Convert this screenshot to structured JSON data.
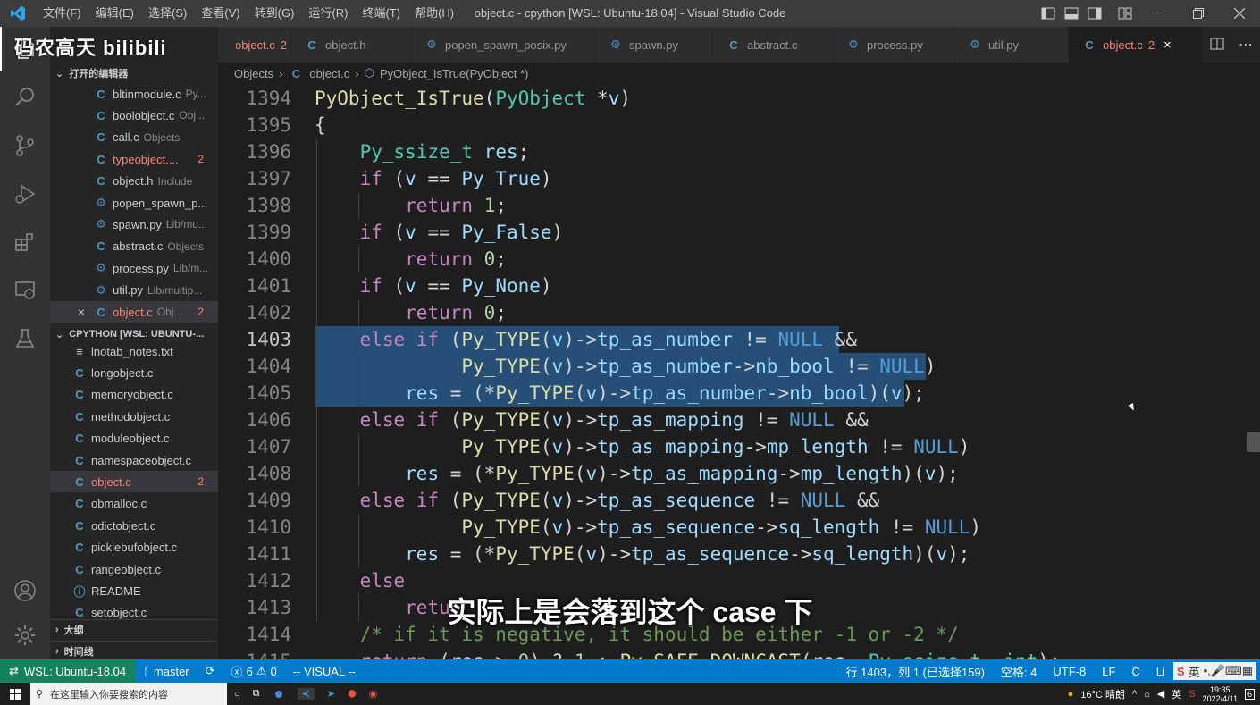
{
  "titlebar": {
    "menu": [
      "文件(F)",
      "编辑(E)",
      "选择(S)",
      "查看(V)",
      "转到(G)",
      "运行(R)",
      "终端(T)",
      "帮助(H)"
    ],
    "window_title": "object.c - cpython [WSL: Ubuntu-18.04] - Visual Studio Code"
  },
  "activity": [
    "files-icon",
    "search-icon",
    "source-control-icon",
    "run-debug-icon",
    "extensions-icon",
    "remote-explorer-icon",
    "testing-icon",
    "account-icon",
    "settings-gear-icon"
  ],
  "sidebar": {
    "open_editors_header": "打开的编辑器",
    "open_editors": [
      {
        "name": "bltinmodule.c",
        "desc": "Py...",
        "icon": "C",
        "error": false,
        "badge": ""
      },
      {
        "name": "boolobject.c",
        "desc": "Obj...",
        "icon": "C",
        "error": false,
        "badge": ""
      },
      {
        "name": "call.c",
        "desc": "Objects",
        "icon": "C",
        "error": false,
        "badge": ""
      },
      {
        "name": "typeobject....",
        "desc": "",
        "icon": "C",
        "error": true,
        "badge": "2"
      },
      {
        "name": "object.h",
        "desc": "Include",
        "icon": "C",
        "error": false,
        "badge": ""
      },
      {
        "name": "popen_spawn_p...",
        "desc": "",
        "icon": "py",
        "error": false,
        "badge": ""
      },
      {
        "name": "spawn.py",
        "desc": "Lib/mu...",
        "icon": "py",
        "error": false,
        "badge": ""
      },
      {
        "name": "abstract.c",
        "desc": "Objects",
        "icon": "C",
        "error": false,
        "badge": ""
      },
      {
        "name": "process.py",
        "desc": "Lib/m...",
        "icon": "py",
        "error": false,
        "badge": ""
      },
      {
        "name": "util.py",
        "desc": "Lib/multip...",
        "icon": "py",
        "error": false,
        "badge": ""
      },
      {
        "name": "object.c",
        "desc": "Obj...",
        "icon": "C",
        "error": true,
        "badge": "2"
      }
    ],
    "workspace_header": "CPYTHON [WSL: UBUNTU-...",
    "files": [
      {
        "name": "lnotab_notes.txt",
        "icon": "txt",
        "error": false,
        "badge": ""
      },
      {
        "name": "longobject.c",
        "icon": "C",
        "error": false,
        "badge": ""
      },
      {
        "name": "memoryobject.c",
        "icon": "C",
        "error": false,
        "badge": ""
      },
      {
        "name": "methodobject.c",
        "icon": "C",
        "error": false,
        "badge": ""
      },
      {
        "name": "moduleobject.c",
        "icon": "C",
        "error": false,
        "badge": ""
      },
      {
        "name": "namespaceobject.c",
        "icon": "C",
        "error": false,
        "badge": ""
      },
      {
        "name": "object.c",
        "icon": "C",
        "error": true,
        "badge": "2"
      },
      {
        "name": "obmalloc.c",
        "icon": "C",
        "error": false,
        "badge": ""
      },
      {
        "name": "odictobject.c",
        "icon": "C",
        "error": false,
        "badge": ""
      },
      {
        "name": "picklebufobject.c",
        "icon": "C",
        "error": false,
        "badge": ""
      },
      {
        "name": "rangeobject.c",
        "icon": "C",
        "error": false,
        "badge": ""
      },
      {
        "name": "README",
        "icon": "info",
        "error": false,
        "badge": ""
      },
      {
        "name": "setobject.c",
        "icon": "C",
        "error": false,
        "badge": ""
      }
    ],
    "outline_header": "大纲",
    "timeline_header": "时间线"
  },
  "tabs": [
    {
      "name": "typeobject.c",
      "icon": "C",
      "badge": "2",
      "error": true,
      "active": false
    },
    {
      "name": "object.h",
      "icon": "C",
      "badge": "",
      "error": false,
      "active": false
    },
    {
      "name": "popen_spawn_posix.py",
      "icon": "py",
      "badge": "",
      "error": false,
      "active": false
    },
    {
      "name": "spawn.py",
      "icon": "py",
      "badge": "",
      "error": false,
      "active": false
    },
    {
      "name": "abstract.c",
      "icon": "C",
      "badge": "",
      "error": false,
      "active": false
    },
    {
      "name": "process.py",
      "icon": "py",
      "badge": "",
      "error": false,
      "active": false
    },
    {
      "name": "util.py",
      "icon": "py",
      "badge": "",
      "error": false,
      "active": false
    },
    {
      "name": "object.c",
      "icon": "C",
      "badge": "2",
      "error": true,
      "active": true
    }
  ],
  "breadcrumb": {
    "folder": "Objects",
    "file": "object.c",
    "symbol": "PyObject_IsTrue(PyObject *)"
  },
  "editor": {
    "lines": [
      {
        "num": "1394",
        "tokens": [
          [
            "f",
            "PyObject_IsTrue"
          ],
          [
            "",
            "("
          ],
          [
            "t",
            "PyObject"
          ],
          [
            "",
            " *"
          ],
          [
            "v",
            "v"
          ],
          [
            "",
            ")"
          ]
        ]
      },
      {
        "num": "1395",
        "tokens": [
          [
            "",
            "{"
          ]
        ]
      },
      {
        "num": "1396",
        "tokens": [
          [
            "",
            "    "
          ],
          [
            "t",
            "Py_ssize_t"
          ],
          [
            "",
            " "
          ],
          [
            "v",
            "res"
          ],
          [
            "",
            ";"
          ]
        ]
      },
      {
        "num": "1397",
        "tokens": [
          [
            "",
            "    "
          ],
          [
            "k",
            "if"
          ],
          [
            "",
            " ("
          ],
          [
            "v",
            "v"
          ],
          [
            "",
            " == "
          ],
          [
            "v",
            "Py_True"
          ],
          [
            "",
            ")"
          ]
        ]
      },
      {
        "num": "1398",
        "tokens": [
          [
            "",
            "        "
          ],
          [
            "k",
            "return"
          ],
          [
            "",
            " "
          ],
          [
            "n",
            "1"
          ],
          [
            "",
            ";"
          ]
        ]
      },
      {
        "num": "1399",
        "tokens": [
          [
            "",
            "    "
          ],
          [
            "k",
            "if"
          ],
          [
            "",
            " ("
          ],
          [
            "v",
            "v"
          ],
          [
            "",
            " == "
          ],
          [
            "v",
            "Py_False"
          ],
          [
            "",
            ")"
          ]
        ]
      },
      {
        "num": "1400",
        "tokens": [
          [
            "",
            "        "
          ],
          [
            "k",
            "return"
          ],
          [
            "",
            " "
          ],
          [
            "n",
            "0"
          ],
          [
            "",
            ";"
          ]
        ]
      },
      {
        "num": "1401",
        "tokens": [
          [
            "",
            "    "
          ],
          [
            "k",
            "if"
          ],
          [
            "",
            " ("
          ],
          [
            "v",
            "v"
          ],
          [
            "",
            " == "
          ],
          [
            "v",
            "Py_None"
          ],
          [
            "",
            ")"
          ]
        ]
      },
      {
        "num": "1402",
        "tokens": [
          [
            "",
            "        "
          ],
          [
            "k",
            "return"
          ],
          [
            "",
            " "
          ],
          [
            "n",
            "0"
          ],
          [
            "",
            ";"
          ]
        ]
      },
      {
        "num": "1403",
        "tokens": [
          [
            "",
            "    "
          ],
          [
            "k",
            "else if"
          ],
          [
            "",
            " ("
          ],
          [
            "f",
            "Py_TYPE"
          ],
          [
            "",
            "("
          ],
          [
            "v",
            "v"
          ],
          [
            "",
            ")->"
          ],
          [
            "v",
            "tp_as_number"
          ],
          [
            "",
            " != "
          ],
          [
            "m",
            "NULL"
          ],
          [
            "",
            " &&"
          ]
        ]
      },
      {
        "num": "1404",
        "tokens": [
          [
            "",
            "             "
          ],
          [
            "f",
            "Py_TYPE"
          ],
          [
            "",
            "("
          ],
          [
            "v",
            "v"
          ],
          [
            "",
            ")->"
          ],
          [
            "v",
            "tp_as_number"
          ],
          [
            "",
            "->"
          ],
          [
            "v",
            "nb_bool"
          ],
          [
            "",
            " != "
          ],
          [
            "m",
            "NULL"
          ],
          [
            "",
            ")"
          ]
        ]
      },
      {
        "num": "1405",
        "tokens": [
          [
            "",
            "        "
          ],
          [
            "v",
            "res"
          ],
          [
            "",
            " = (*"
          ],
          [
            "f",
            "Py_TYPE"
          ],
          [
            "",
            "("
          ],
          [
            "v",
            "v"
          ],
          [
            "",
            ")->"
          ],
          [
            "v",
            "tp_as_number"
          ],
          [
            "",
            "->"
          ],
          [
            "v",
            "nb_bool"
          ],
          [
            "",
            ")("
          ],
          [
            "v",
            "v"
          ],
          [
            "",
            ");"
          ]
        ]
      },
      {
        "num": "1406",
        "tokens": [
          [
            "",
            "    "
          ],
          [
            "k",
            "else if"
          ],
          [
            "",
            " ("
          ],
          [
            "f",
            "Py_TYPE"
          ],
          [
            "",
            "("
          ],
          [
            "v",
            "v"
          ],
          [
            "",
            ")->"
          ],
          [
            "v",
            "tp_as_mapping"
          ],
          [
            "",
            " != "
          ],
          [
            "m",
            "NULL"
          ],
          [
            "",
            " &&"
          ]
        ]
      },
      {
        "num": "1407",
        "tokens": [
          [
            "",
            "             "
          ],
          [
            "f",
            "Py_TYPE"
          ],
          [
            "",
            "("
          ],
          [
            "v",
            "v"
          ],
          [
            "",
            ")->"
          ],
          [
            "v",
            "tp_as_mapping"
          ],
          [
            "",
            "->"
          ],
          [
            "v",
            "mp_length"
          ],
          [
            "",
            " != "
          ],
          [
            "m",
            "NULL"
          ],
          [
            "",
            ")"
          ]
        ]
      },
      {
        "num": "1408",
        "tokens": [
          [
            "",
            "        "
          ],
          [
            "v",
            "res"
          ],
          [
            "",
            " = (*"
          ],
          [
            "f",
            "Py_TYPE"
          ],
          [
            "",
            "("
          ],
          [
            "v",
            "v"
          ],
          [
            "",
            ")->"
          ],
          [
            "v",
            "tp_as_mapping"
          ],
          [
            "",
            "->"
          ],
          [
            "v",
            "mp_length"
          ],
          [
            "",
            ")("
          ],
          [
            "v",
            "v"
          ],
          [
            "",
            ");"
          ]
        ]
      },
      {
        "num": "1409",
        "tokens": [
          [
            "",
            "    "
          ],
          [
            "k",
            "else if"
          ],
          [
            "",
            " ("
          ],
          [
            "f",
            "Py_TYPE"
          ],
          [
            "",
            "("
          ],
          [
            "v",
            "v"
          ],
          [
            "",
            ")->"
          ],
          [
            "v",
            "tp_as_sequence"
          ],
          [
            "",
            " != "
          ],
          [
            "m",
            "NULL"
          ],
          [
            "",
            " &&"
          ]
        ]
      },
      {
        "num": "1410",
        "tokens": [
          [
            "",
            "             "
          ],
          [
            "f",
            "Py_TYPE"
          ],
          [
            "",
            "("
          ],
          [
            "v",
            "v"
          ],
          [
            "",
            ")->"
          ],
          [
            "v",
            "tp_as_sequence"
          ],
          [
            "",
            "->"
          ],
          [
            "v",
            "sq_length"
          ],
          [
            "",
            " != "
          ],
          [
            "m",
            "NULL"
          ],
          [
            "",
            ")"
          ]
        ]
      },
      {
        "num": "1411",
        "tokens": [
          [
            "",
            "        "
          ],
          [
            "v",
            "res"
          ],
          [
            "",
            " = (*"
          ],
          [
            "f",
            "Py_TYPE"
          ],
          [
            "",
            "("
          ],
          [
            "v",
            "v"
          ],
          [
            "",
            ")->"
          ],
          [
            "v",
            "tp_as_sequence"
          ],
          [
            "",
            "->"
          ],
          [
            "v",
            "sq_length"
          ],
          [
            "",
            ")("
          ],
          [
            "v",
            "v"
          ],
          [
            "",
            ");"
          ]
        ]
      },
      {
        "num": "1412",
        "tokens": [
          [
            "",
            "    "
          ],
          [
            "k",
            "else"
          ]
        ]
      },
      {
        "num": "1413",
        "tokens": [
          [
            "",
            "        "
          ],
          [
            "k",
            "retu"
          ]
        ]
      },
      {
        "num": "1414",
        "tokens": [
          [
            "",
            "    "
          ],
          [
            "c",
            "/* if it is negative, it should be either -1 or -2 */"
          ]
        ]
      },
      {
        "num": "1415",
        "tokens": [
          [
            "",
            "    "
          ],
          [
            "k",
            "return"
          ],
          [
            "",
            " ("
          ],
          [
            "v",
            "res"
          ],
          [
            "",
            " > "
          ],
          [
            "n",
            "0"
          ],
          [
            "",
            ") ? "
          ],
          [
            "n",
            "1"
          ],
          [
            "",
            " : "
          ],
          [
            "f",
            "Py_SAFE_DOWNCAST"
          ],
          [
            "",
            "("
          ],
          [
            "v",
            "res"
          ],
          [
            "",
            ", "
          ],
          [
            "t",
            "Py_ssize_t"
          ],
          [
            "",
            ", "
          ],
          [
            "t",
            "int"
          ],
          [
            "",
            ");"
          ]
        ]
      }
    ]
  },
  "status": {
    "remote": "WSL: Ubuntu-18.04",
    "branch": "master",
    "errors": "6",
    "warnings": "0",
    "mode": "-- VISUAL --",
    "position": "行 1403，列 1 (已选择159)",
    "spaces": "空格: 4",
    "encoding": "UTF-8",
    "eol": "LF",
    "language": "C",
    "extra": "Li"
  },
  "taskbar": {
    "search_placeholder": "在这里输入你要搜索的内容",
    "weather": "16°C 晴朗",
    "ime": "英",
    "time": "19:35",
    "date": "2022/4/11",
    "notif": "6"
  },
  "overlay": {
    "watermark": "码农高天 bilibili",
    "subtitle": "实际上是会落到这个 case 下"
  },
  "colors": {
    "accent": "#007acc",
    "remote": "#16825d",
    "error": "#f48771",
    "selection": "#264f78"
  }
}
